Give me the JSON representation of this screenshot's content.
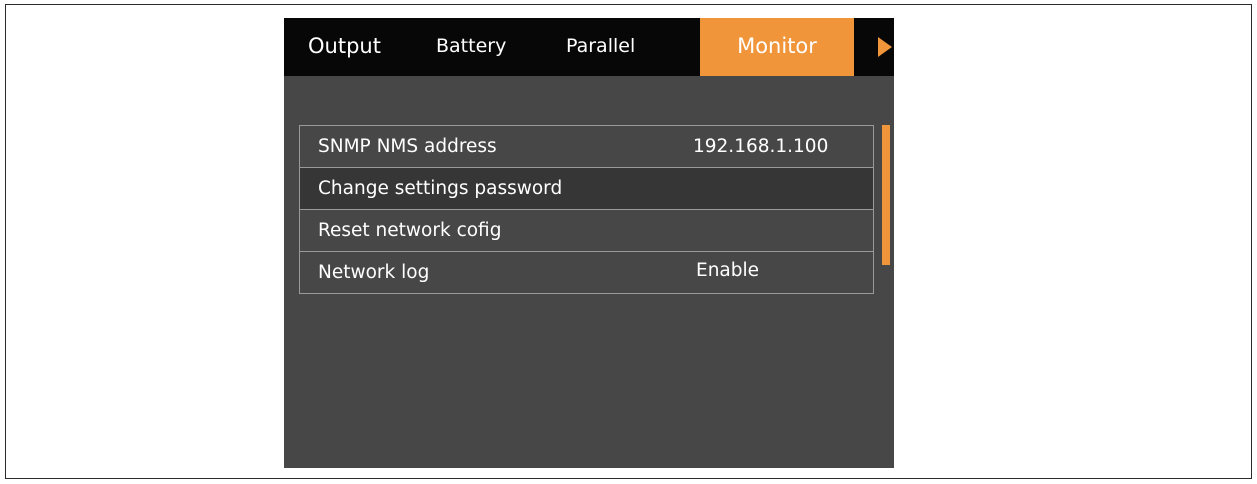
{
  "tabs": [
    {
      "label": "Output",
      "active": false
    },
    {
      "label": "Battery",
      "active": false
    },
    {
      "label": "Parallel",
      "active": false
    },
    {
      "label": "Monitor",
      "active": true
    }
  ],
  "tab_next_icon": "play-arrow-icon",
  "settings": [
    {
      "label": "SNMP NMS address",
      "value": "192.168.1.100"
    },
    {
      "label": "Change settings password",
      "value": ""
    },
    {
      "label": "Reset network cofig",
      "value": ""
    },
    {
      "label": "Network log",
      "value": "Enable"
    }
  ],
  "selected_setting_index": 1,
  "colors": {
    "accent": "#f0953a",
    "tab_bar": "#070707",
    "screen_bg": "#474747",
    "selected_row": "#363636",
    "text": "#ffffff"
  }
}
